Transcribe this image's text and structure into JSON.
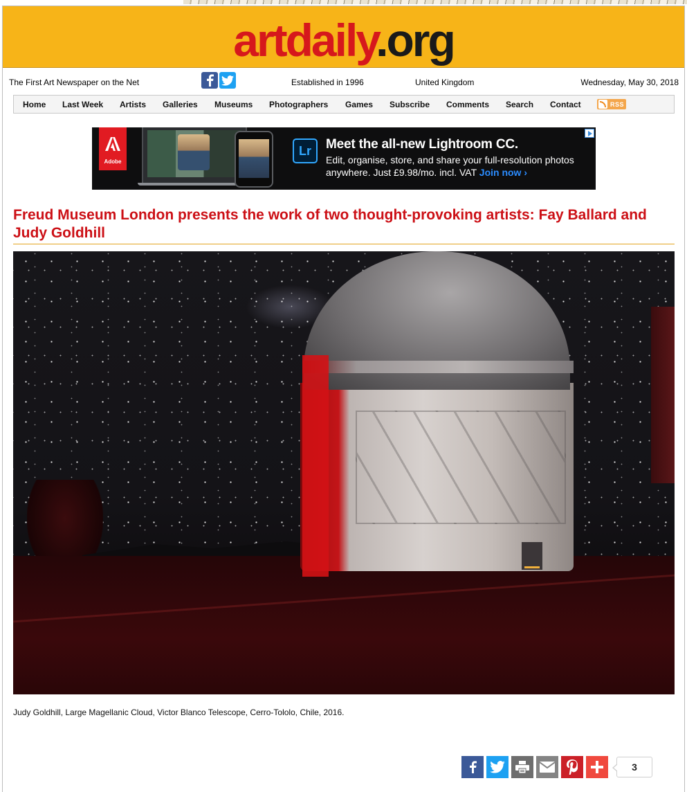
{
  "site": {
    "logo_main": "artdaily",
    "logo_tld": ".org",
    "tagline": "The First Art Newspaper on the Net",
    "established": "Established in 1996",
    "region": "United Kingdom",
    "date": "Wednesday, May 30, 2018"
  },
  "nav": {
    "items": [
      {
        "label": "Home"
      },
      {
        "label": "Last Week"
      },
      {
        "label": "Artists"
      },
      {
        "label": "Galleries"
      },
      {
        "label": "Museums"
      },
      {
        "label": "Photographers"
      },
      {
        "label": "Games"
      },
      {
        "label": "Subscribe"
      },
      {
        "label": "Comments"
      },
      {
        "label": "Search"
      },
      {
        "label": "Contact"
      }
    ],
    "rss_label": "RSS"
  },
  "ad": {
    "brand": "Adobe",
    "product_badge": "Lr",
    "headline": "Meet the all-new Lightroom CC.",
    "body": "Edit, organise, store, and share your full-resolution photos anywhere. Just £9.98/mo. incl. VAT",
    "cta": "Join now ›"
  },
  "article": {
    "title": "Freud Museum London presents the work of two thought-provoking artists: Fay Ballard and Judy Goldhill",
    "caption": "Judy Goldhill, Large Magellanic Cloud, Victor Blanco Telescope, Cerro-Tololo, Chile, 2016."
  },
  "share": {
    "count": "3"
  },
  "colors": {
    "banner": "#f7b418",
    "logo_red": "#d6181c",
    "title_red": "#cc1016",
    "facebook": "#3b5998",
    "twitter": "#1da1f2",
    "pinterest": "#cb2027"
  }
}
